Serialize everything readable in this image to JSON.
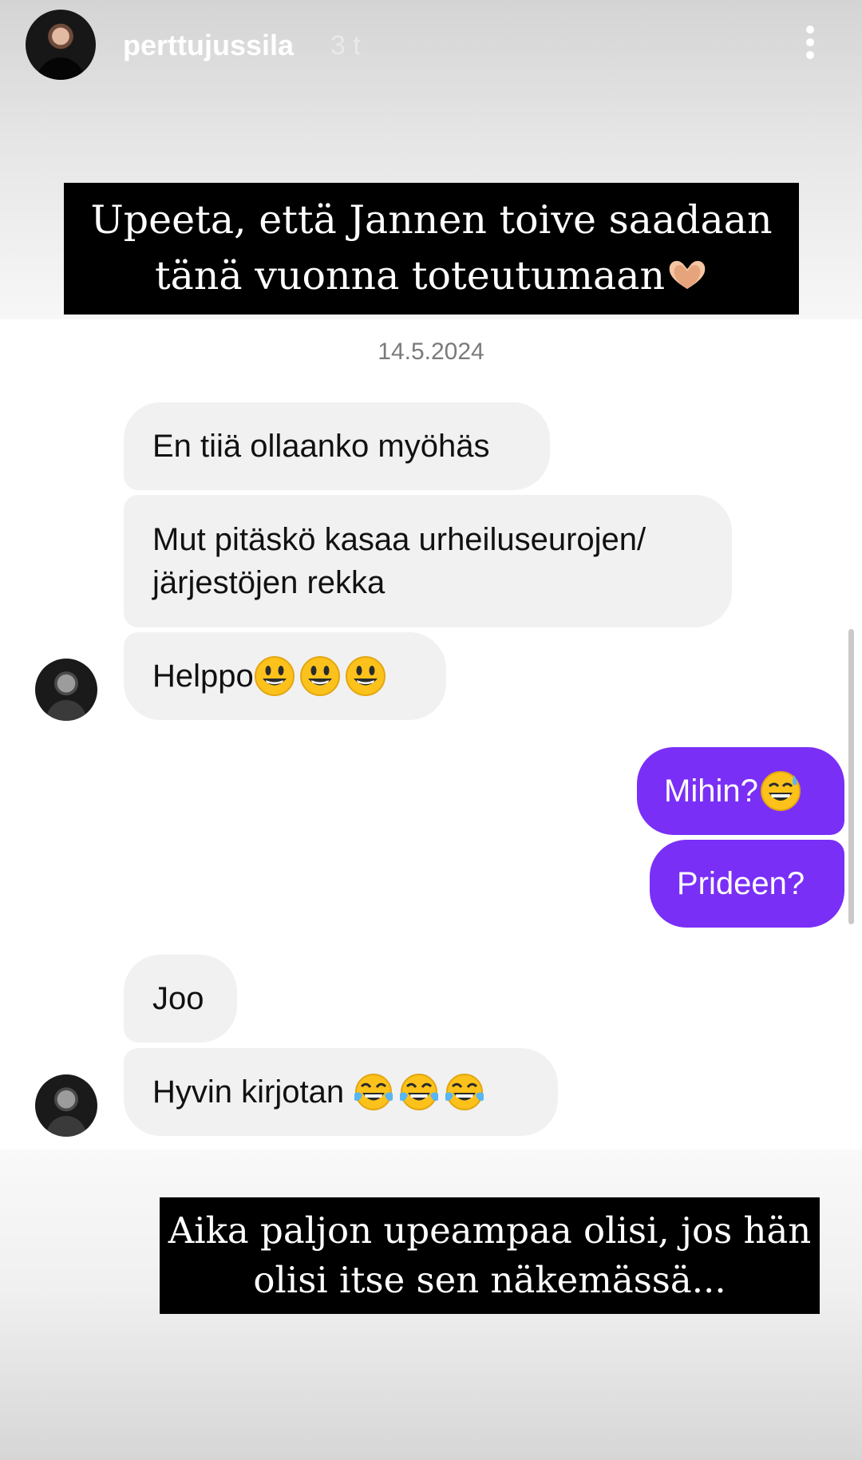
{
  "story": {
    "username": "perttujussila",
    "time": "3 t",
    "more_icon": "more-vertical-icon"
  },
  "overlay_top": {
    "line1": "Upeeta, että Jannen toive saadaan",
    "line2": "tänä vuonna toteutumaan",
    "emoji": "heart-hands-icon"
  },
  "chat": {
    "date": "14.5.2024",
    "messages": [
      {
        "from": "them",
        "text": "En tiiä ollaanko myöhäs"
      },
      {
        "from": "them",
        "line1": "Mut pitäskö kasaa urheiluseurojen/",
        "line2": "järjestöjen rekka"
      },
      {
        "from": "them",
        "text": "Helppo",
        "emoji": "smiley-icon",
        "emoji_count": 3
      },
      {
        "from": "me",
        "text": "Mihin?",
        "emoji": "grinning-sweat-icon"
      },
      {
        "from": "me",
        "text": "Prideen?"
      },
      {
        "from": "them",
        "text": "Joo"
      },
      {
        "from": "them",
        "text": "Hyvin kirjotan ",
        "emoji": "tears-of-joy-icon",
        "emoji_count": 3
      }
    ],
    "colors": {
      "outgoing": "#7a2ff6",
      "incoming": "#f1f1f2"
    }
  },
  "overlay_bottom": {
    "line1": "Aika paljon upeampaa olisi, jos hän",
    "line2": "olisi itse sen näkemässä..."
  }
}
